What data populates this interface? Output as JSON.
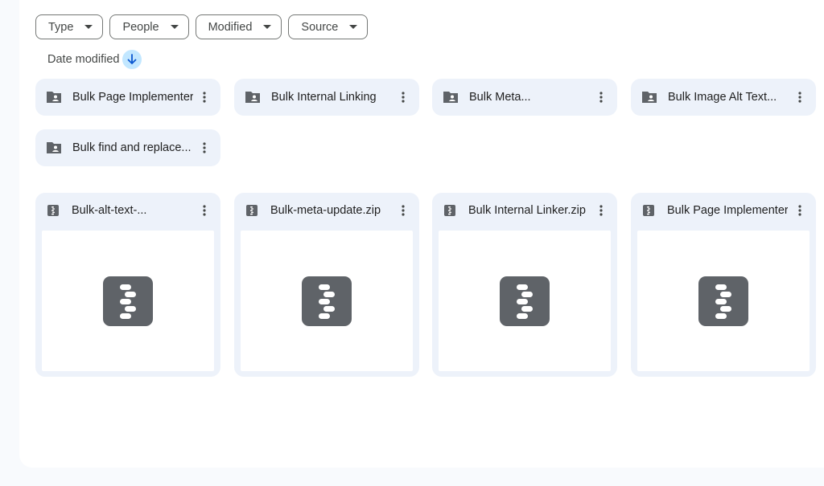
{
  "filters": [
    {
      "label": "Type"
    },
    {
      "label": "People"
    },
    {
      "label": "Modified"
    },
    {
      "label": "Source"
    }
  ],
  "sort": {
    "label": "Date modified",
    "direction": "descending"
  },
  "folders": [
    {
      "name": "Bulk Page Implementer"
    },
    {
      "name": "Bulk Internal Linking"
    },
    {
      "name": "Bulk Meta..."
    },
    {
      "name": "Bulk Image Alt Text..."
    },
    {
      "name": "Bulk find and replace..."
    }
  ],
  "files": [
    {
      "name": "Bulk-alt-text-..."
    },
    {
      "name": "Bulk-meta-update.zip"
    },
    {
      "name": "Bulk Internal Linker.zip"
    },
    {
      "name": "Bulk Page Implementer"
    }
  ],
  "colors": {
    "canvas": "#f8fafd",
    "card": "#edf2fa",
    "icon": "#5f6368",
    "sort_accent": "#c2e7ff",
    "sort_arrow": "#0b57d0"
  },
  "icons": {
    "folder": "shared-folder-icon",
    "file": "zip-archive-icon",
    "menu": "more-vert-icon",
    "caret": "caret-down-icon",
    "sort": "arrow-down-icon"
  }
}
